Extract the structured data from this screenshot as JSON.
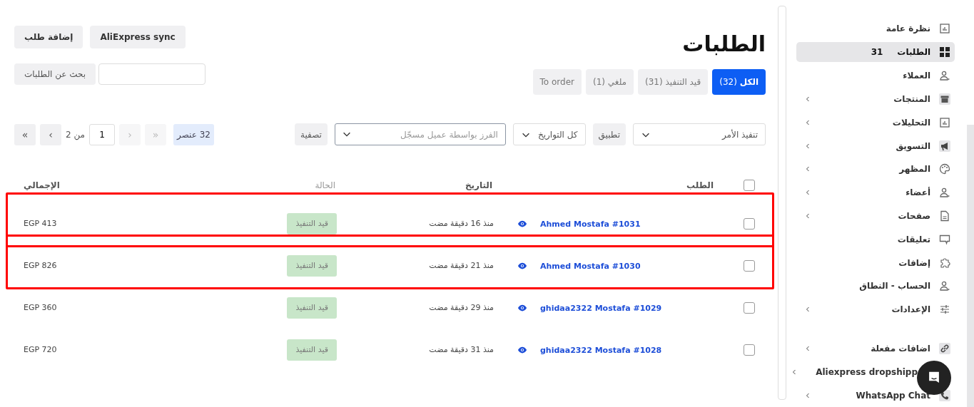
{
  "sidebar": {
    "items": [
      {
        "kind": "chart",
        "label": "نظرة عامة",
        "selected": false,
        "expandable": false
      },
      {
        "kind": "grid",
        "label": "الطلبات",
        "count": "31",
        "selected": true,
        "expandable": false
      },
      {
        "kind": "users",
        "label": "العملاء",
        "selected": false,
        "expandable": false
      },
      {
        "kind": "box",
        "label": "المنتجات",
        "selected": false,
        "expandable": true
      },
      {
        "kind": "chart",
        "label": "التحليلات",
        "selected": false,
        "expandable": true
      },
      {
        "kind": "megaphone",
        "label": "التسويق",
        "selected": false,
        "expandable": true
      },
      {
        "kind": "palette",
        "label": "المظهر",
        "selected": false,
        "expandable": true
      },
      {
        "kind": "users",
        "label": "أعضاء",
        "selected": false,
        "expandable": true
      },
      {
        "kind": "file",
        "label": "صفحات",
        "selected": false,
        "expandable": true
      },
      {
        "kind": "comment",
        "label": "تعليقات",
        "selected": false,
        "expandable": false
      },
      {
        "kind": "puzzle",
        "label": "إضافات",
        "selected": false,
        "expandable": false
      },
      {
        "kind": "users",
        "label": "الحساب - النطاق",
        "selected": false,
        "expandable": false
      },
      {
        "kind": "sliders",
        "label": "الإعدادات",
        "selected": false,
        "expandable": true
      }
    ],
    "extensions": [
      {
        "kind": "link",
        "label": "اضافات مفعلة",
        "selected": false,
        "expandable": true
      },
      {
        "kind": "covered",
        "label": "Aliexpress dropshipp",
        "selected": false,
        "expandable": true
      },
      {
        "kind": "phone",
        "label": "WhatsApp Chat",
        "selected": false,
        "expandable": true
      }
    ]
  },
  "page": {
    "title": "الطلبات",
    "buttons": [
      "AliExpress sync",
      "إضافة طلب"
    ]
  },
  "tabs": [
    {
      "label": "الكل",
      "count": "(32)",
      "selected": true
    },
    {
      "label": "قيد التنفيذ",
      "count": "(31)",
      "selected": false
    },
    {
      "label": "ملغي",
      "count": "(1)",
      "selected": false
    },
    {
      "label": "To order",
      "selected": false
    }
  ],
  "search": {
    "button": "بحث عن الطلبات"
  },
  "filters": {
    "bulk_action": "تنفيذ الأمر",
    "apply": "تطبيق",
    "dates": "كل التواريخ",
    "customer": {
      "placeholder": "الفرز بواسطة عميل مسجّل"
    },
    "filter": "تصفية"
  },
  "pagination": {
    "items": "32 عنصر",
    "first": "«",
    "prev": "‹",
    "page": "1",
    "of": "من 2",
    "next": "›",
    "last": "»"
  },
  "table": {
    "all_checked": false,
    "columns": [
      "الطلب",
      "التاريخ",
      "الحالة",
      "الإجمالي"
    ],
    "rows": [
      {
        "order": "Ahmed Mostafa #1031",
        "date": "منذ 16 دقيقة مضت",
        "status": "قيد التنفيذ",
        "total": "EGP 413",
        "checked": false,
        "highlighted": true
      },
      {
        "order": "Ahmed Mostafa #1030",
        "date": "منذ 21 دقيقة مضت",
        "status": "قيد التنفيذ",
        "total": "EGP 826",
        "checked": false,
        "highlighted": true
      },
      {
        "order": "ghidaa2322 Mostafa #1029",
        "date": "منذ 29 دقيقة مضت",
        "status": "قيد التنفيذ",
        "total": "EGP 360",
        "checked": false,
        "highlighted": false
      },
      {
        "order": "ghidaa2322 Mostafa #1028",
        "date": "منذ 31 دقيقة مضت",
        "status": "قيد التنفيذ",
        "total": "EGP 720",
        "checked": false,
        "highlighted": false
      }
    ]
  }
}
